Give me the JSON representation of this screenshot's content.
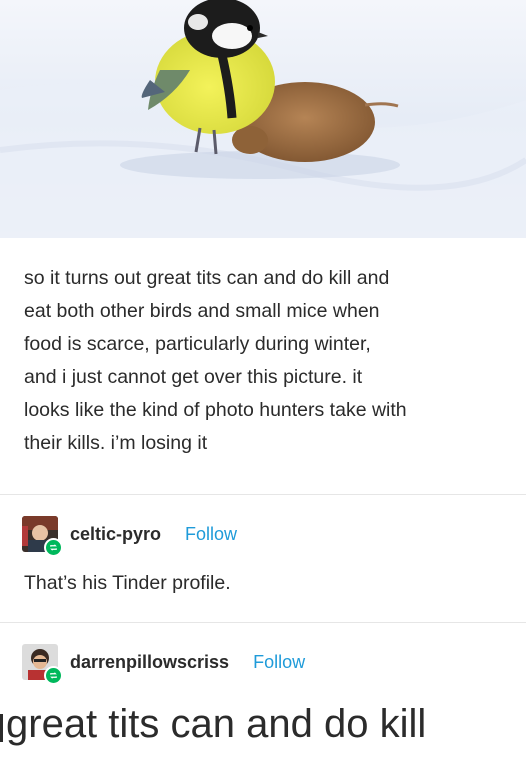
{
  "photo": {
    "description_icon": "great-tit-with-mouse-photo"
  },
  "post": {
    "lines": [
      "so it turns out great tits can and do kill and",
      "eat both other birds and small mice when",
      "food is scarce, particularly during winter,",
      "and i just cannot get over this picture. it",
      "looks like the kind of photo hunters take with",
      "their kills. i’m losing it"
    ]
  },
  "reblogs": [
    {
      "username": "celtic-pyro",
      "follow_label": "Follow",
      "text": "That’s his Tinder profile.",
      "icon": "reblog-icon"
    },
    {
      "username": "darrenpillowscriss",
      "follow_label": "Follow",
      "icon": "reblog-icon"
    }
  ],
  "bottom": {
    "text": "great tits can and do kill"
  },
  "colors": {
    "follow": "#1f9bd9",
    "reblog_badge": "#00b85c",
    "text": "#2b2b2b"
  }
}
